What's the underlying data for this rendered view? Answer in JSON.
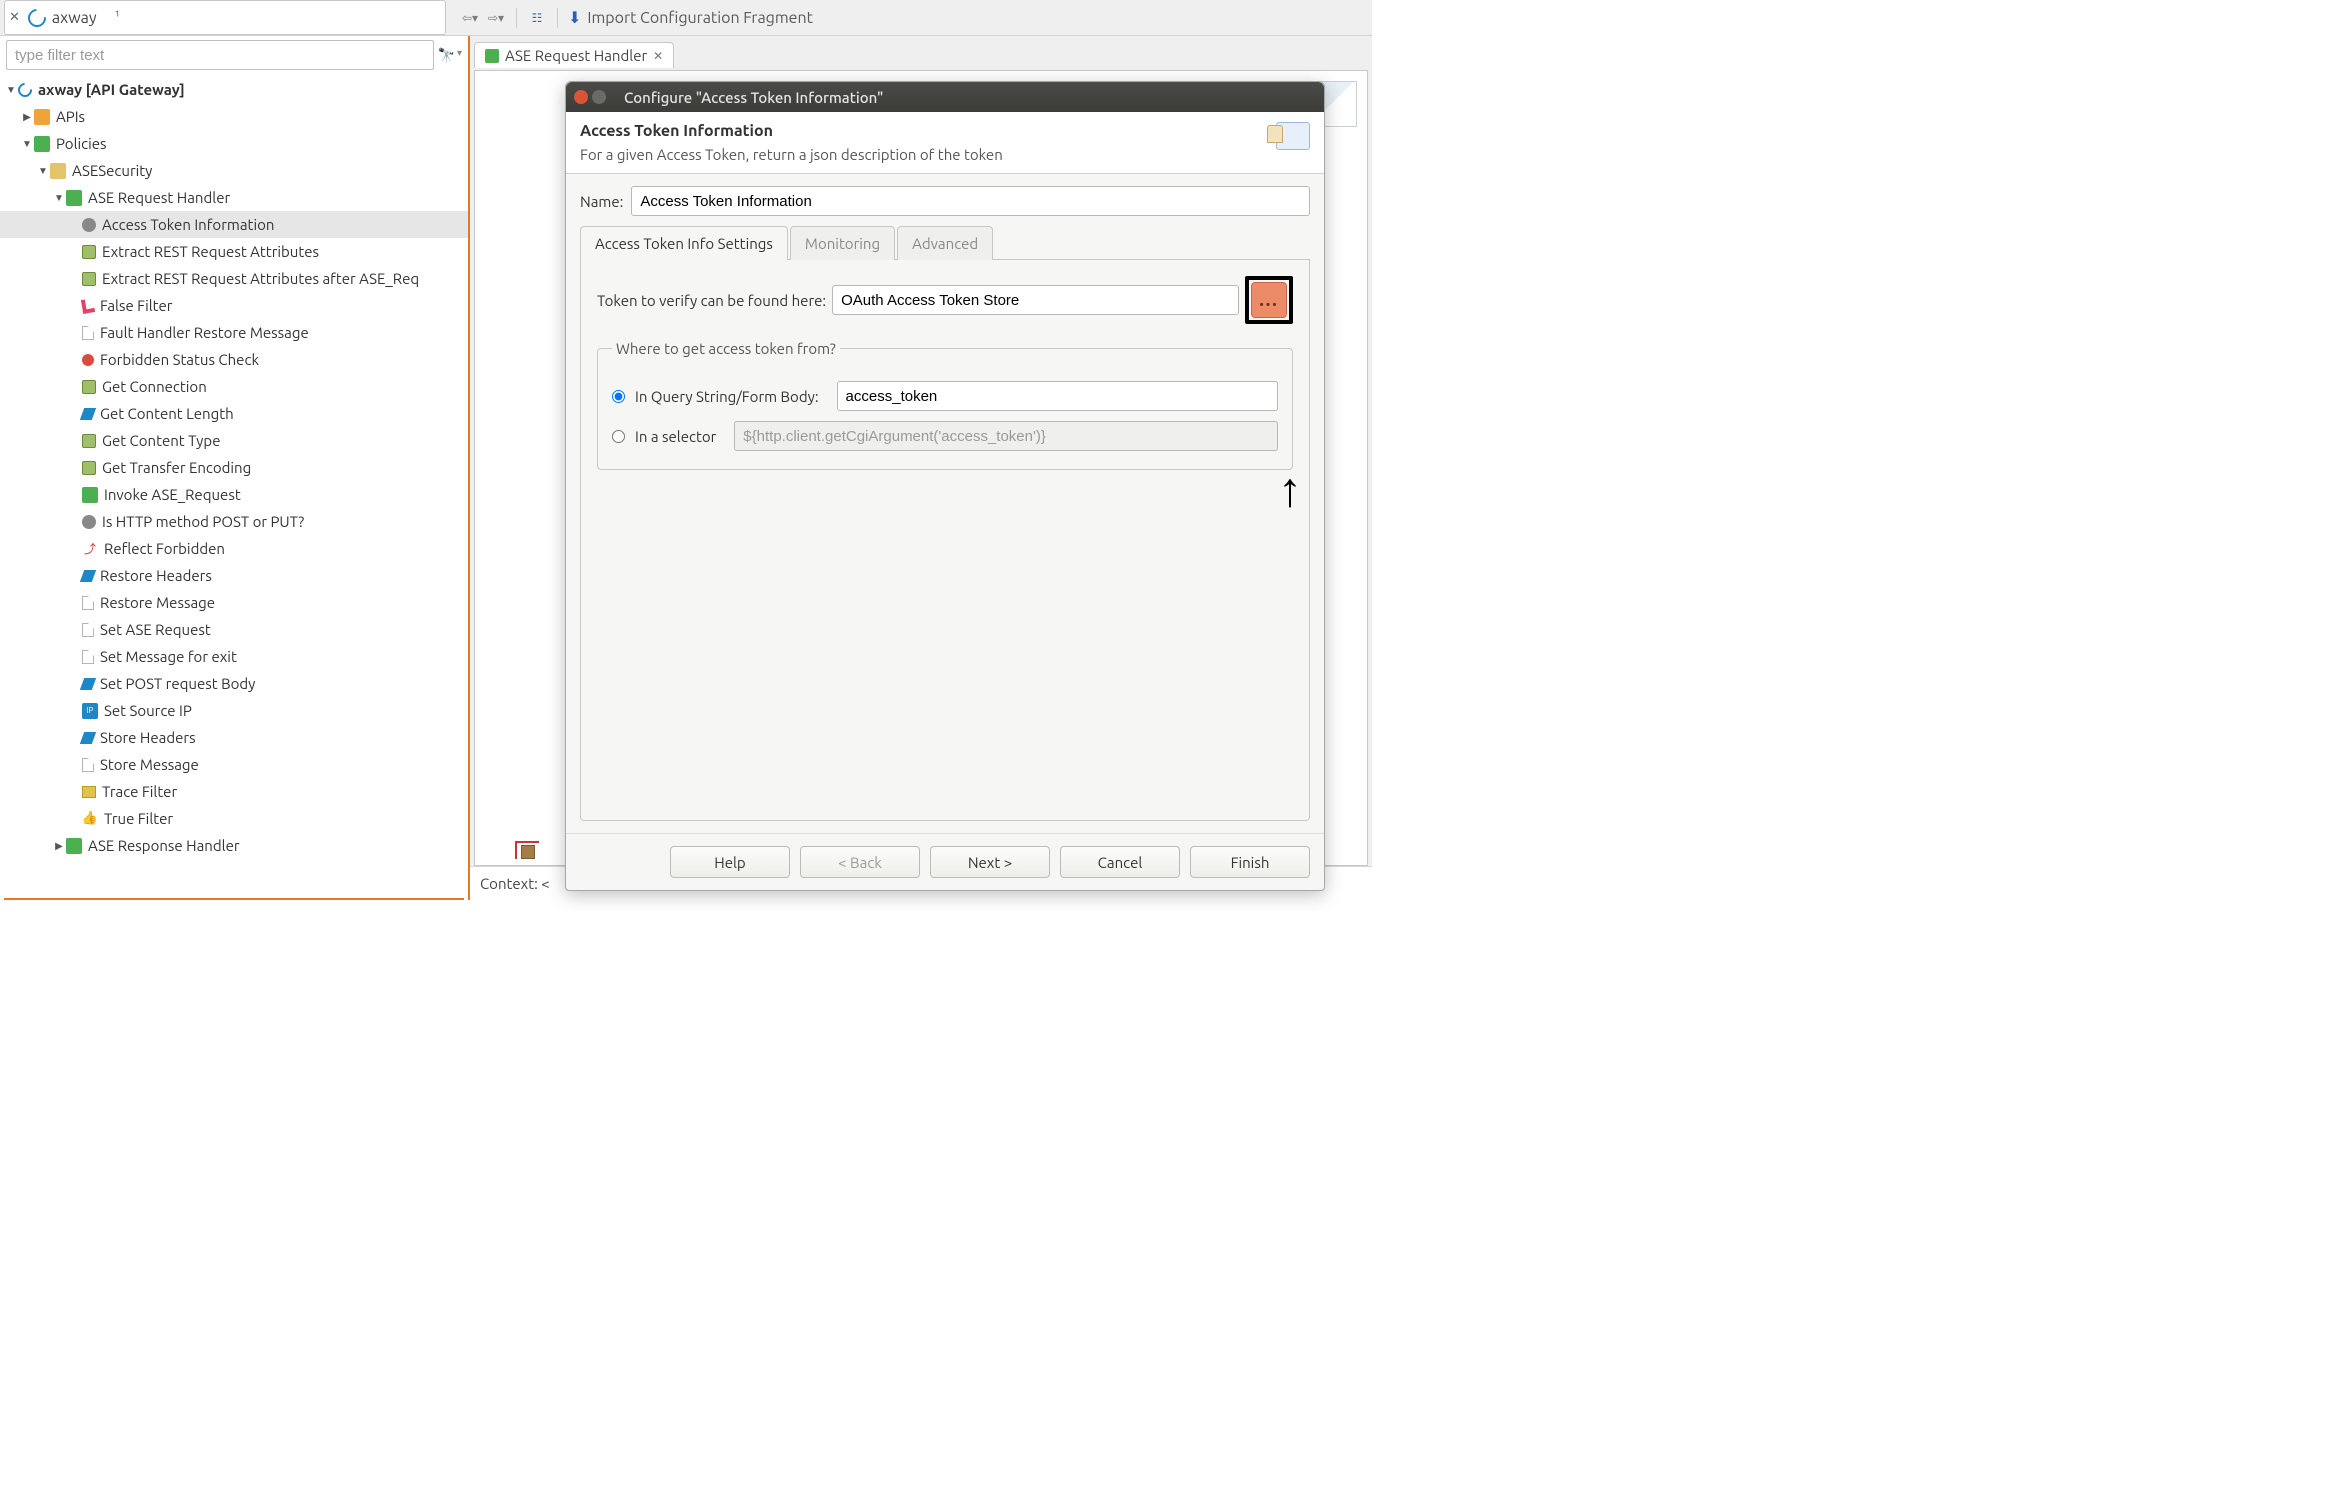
{
  "topbar": {
    "product": "axway",
    "tab_suffix": "¹",
    "import_label": "Import Configuration Fragment"
  },
  "filter": {
    "placeholder": "type filter text"
  },
  "tree": {
    "root": "axway [API Gateway]",
    "apis": "APIs",
    "policies": "Policies",
    "asesecurity": "ASESecurity",
    "ase_request_handler": "ASE Request Handler",
    "items": [
      "Access Token Information",
      "Extract REST Request Attributes",
      "Extract REST Request Attributes after ASE_Req",
      "False Filter",
      "Fault Handler Restore Message",
      "Forbidden Status Check",
      "Get Connection",
      "Get Content Length",
      "Get Content Type",
      "Get Transfer Encoding",
      "Invoke ASE_Request",
      "Is HTTP method POST or PUT?",
      "Reflect Forbidden",
      "Restore Headers",
      "Restore Message",
      "Set ASE Request",
      "Set Message for exit",
      "Set POST request Body",
      "Set Source IP",
      "Store Headers",
      "Store Message",
      "Trace Filter",
      "True Filter"
    ],
    "ase_response_handler": "ASE Response Handler"
  },
  "editor": {
    "tab_title": "ASE Request Handler",
    "context_label": "Context: <"
  },
  "dialog": {
    "window_title": "Configure \"Access Token Information\"",
    "header_title": "Access Token Information",
    "header_desc": "For a given Access Token, return a json description of the token",
    "name_label": "Name:",
    "name_value": "Access Token Information",
    "tabs": {
      "settings": "Access Token Info Settings",
      "monitoring": "Monitoring",
      "advanced": "Advanced"
    },
    "verify_label": "Token to verify can be found here:",
    "verify_value": "OAuth Access Token Store",
    "browse_label": "...",
    "group_legend": "Where to get access token from?",
    "radio1_label": "In Query String/Form Body:",
    "radio1_value": "access_token",
    "radio2_label": "In a selector",
    "radio2_placeholder": "${http.client.getCgiArgument('access_token')}",
    "buttons": {
      "help": "Help",
      "back": "< Back",
      "next": "Next >",
      "cancel": "Cancel",
      "finish": "Finish"
    }
  }
}
